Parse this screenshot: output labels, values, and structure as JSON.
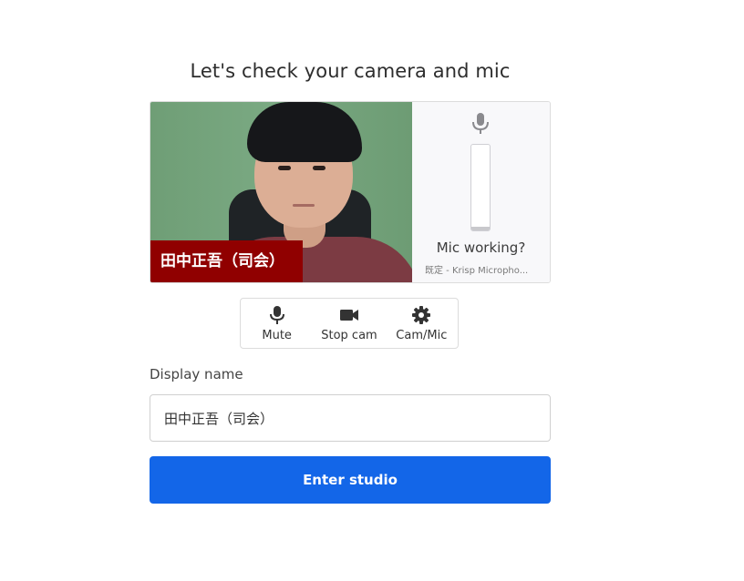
{
  "header": {
    "title": "Let's check your camera and mic"
  },
  "preview": {
    "participant_name": "田中正吾（司会）",
    "mic_panel": {
      "status_text": "Mic working?",
      "device_text": "既定 - Krisp Micropho..."
    }
  },
  "controls": [
    {
      "label": "Mute",
      "icon": "microphone-icon"
    },
    {
      "label": "Stop cam",
      "icon": "video-camera-icon"
    },
    {
      "label": "Cam/Mic",
      "icon": "gear-icon"
    }
  ],
  "form": {
    "display_name_label": "Display name",
    "display_name_value": "田中正吾（司会）",
    "enter_button_label": "Enter studio"
  },
  "colors": {
    "accent": "#1366e8",
    "name_tag_bg": "#900000"
  }
}
